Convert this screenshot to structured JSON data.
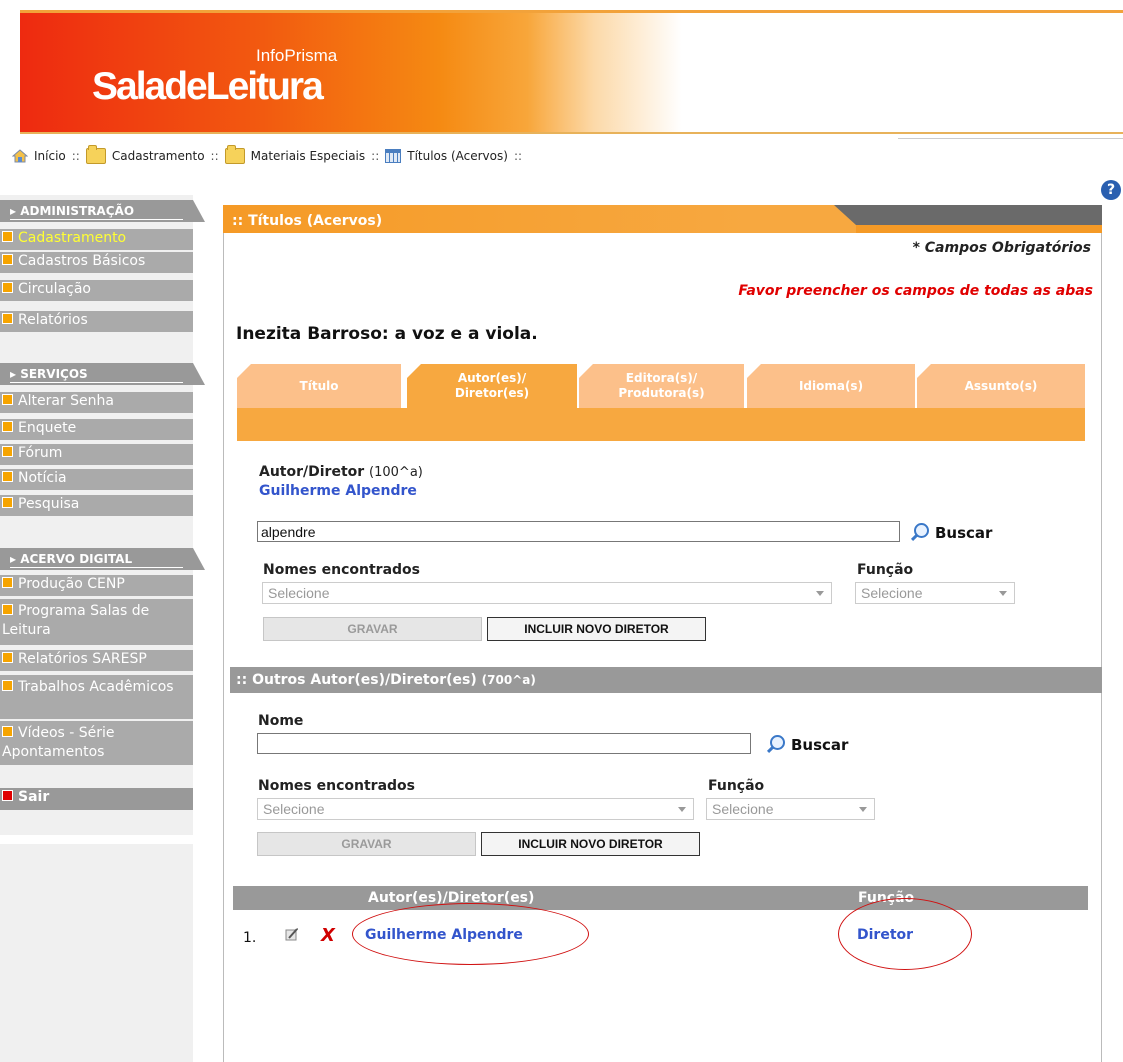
{
  "header": {
    "brand_small": "InfoPrisma",
    "brand_big": "SaladeLeitura"
  },
  "breadcrumb": {
    "items": [
      "Início",
      "Cadastramento",
      "Materiais Especiais",
      "Títulos (Acervos)"
    ],
    "separator": "::"
  },
  "help_icon": "?",
  "sidebar": {
    "sections": [
      {
        "title": "ADMINISTRAÇÃO",
        "items": [
          "Cadastramento",
          "Cadastros Básicos",
          "Circulação",
          "Relatórios"
        ]
      },
      {
        "title": "SERVIÇOS",
        "items": [
          "Alterar Senha",
          "Enquete",
          "Fórum",
          "Notícia",
          "Pesquisa"
        ]
      },
      {
        "title": "ACERVO DIGITAL",
        "items": [
          "Produção CENP",
          "Programa Salas de Leitura",
          "Relatórios SARESP",
          "Trabalhos Acadêmicos",
          "Vídeos - Série Apontamentos"
        ]
      }
    ],
    "active_item": "Cadastramento",
    "exit": "Sair"
  },
  "panel": {
    "title": ":: Títulos (Acervos)",
    "required_note": "* Campos Obrigatórios",
    "warning": "Favor preencher os campos de todas as abas",
    "record_title": "Inezita Barroso: a voz e a viola.",
    "tabs": [
      {
        "line1": "Título",
        "line2": ""
      },
      {
        "line1": "Autor(es)/",
        "line2": "Diretor(es)"
      },
      {
        "line1": "Editora(s)/",
        "line2": "Produtora(s)"
      },
      {
        "line1": "Idioma(s)",
        "line2": ""
      },
      {
        "line1": "Assunto(s)",
        "line2": ""
      }
    ],
    "active_tab": "Autor(es)/Diretor(es)"
  },
  "main_author": {
    "label": "Autor/Diretor",
    "label_code": "(100^a)",
    "selected_name": "Guilherme Alpendre",
    "search_value": "alpendre",
    "search_button": "Buscar",
    "names_label": "Nomes encontrados",
    "names_select": "Selecione",
    "function_label": "Função",
    "function_select": "Selecione",
    "save_button": "GRAVAR",
    "new_button": "INCLUIR NOVO DIRETOR"
  },
  "other_authors": {
    "header": ":: Outros Autor(es)/Diretor(es)",
    "header_code": "(700^a)",
    "name_label": "Nome",
    "name_value": "",
    "search_button": "Buscar",
    "names_label": "Nomes encontrados",
    "names_select": "Selecione",
    "function_label": "Função",
    "function_select": "Selecione",
    "save_button": "GRAVAR",
    "new_button": "INCLUIR NOVO DIRETOR"
  },
  "results": {
    "col_name": "Autor(es)/Diretor(es)",
    "col_function": "Função",
    "rows": [
      {
        "num": "1.",
        "name": "Guilherme Alpendre",
        "function": "Diretor"
      }
    ]
  },
  "colors": {
    "accent_orange": "#f7a840",
    "sidebar_gray": "#aaaaaa",
    "link_blue": "#3355cc",
    "warning_red": "#e00000",
    "annotation_red": "#d01010"
  }
}
